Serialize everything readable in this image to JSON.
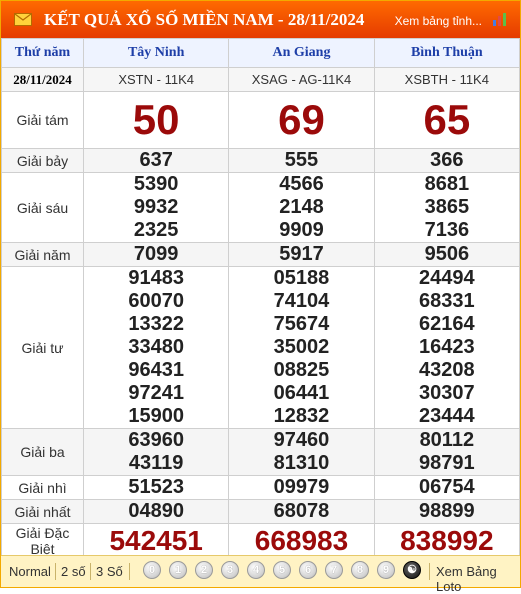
{
  "header": {
    "title": "KẾT QUẢ XỔ SỐ MIỀN NAM - 28/11/2024",
    "view_link": "Xem bảng tỉnh..."
  },
  "columns": {
    "head": "Thứ năm",
    "date": "28/11/2024",
    "provinces": [
      {
        "name": "Tây Ninh",
        "code": "XSTN - 11K4"
      },
      {
        "name": "An Giang",
        "code": "XSAG - AG-11K4"
      },
      {
        "name": "Bình Thuận",
        "code": "XSBTH - 11K4"
      }
    ]
  },
  "prizes": [
    {
      "label": "Giải tám",
      "style": "big",
      "values": [
        [
          "50"
        ],
        [
          "69"
        ],
        [
          "65"
        ]
      ]
    },
    {
      "label": "Giải bảy",
      "style": "num",
      "values": [
        [
          "637"
        ],
        [
          "555"
        ],
        [
          "366"
        ]
      ]
    },
    {
      "label": "Giải sáu",
      "style": "num",
      "values": [
        [
          "5390",
          "9932",
          "2325"
        ],
        [
          "4566",
          "2148",
          "9909"
        ],
        [
          "8681",
          "3865",
          "7136"
        ]
      ]
    },
    {
      "label": "Giải năm",
      "style": "num",
      "values": [
        [
          "7099"
        ],
        [
          "5917"
        ],
        [
          "9506"
        ]
      ]
    },
    {
      "label": "Giải tư",
      "style": "num",
      "values": [
        [
          "91483",
          "60070",
          "13322",
          "33480",
          "96431",
          "97241",
          "15900"
        ],
        [
          "05188",
          "74104",
          "75674",
          "35002",
          "08825",
          "06441",
          "12832"
        ],
        [
          "24494",
          "68331",
          "62164",
          "16423",
          "43208",
          "30307",
          "23444"
        ]
      ]
    },
    {
      "label": "Giải ba",
      "style": "num",
      "values": [
        [
          "63960",
          "43119"
        ],
        [
          "97460",
          "81310"
        ],
        [
          "80112",
          "98791"
        ]
      ]
    },
    {
      "label": "Giải nhì",
      "style": "num",
      "values": [
        [
          "51523"
        ],
        [
          "09979"
        ],
        [
          "06754"
        ]
      ]
    },
    {
      "label": "Giải nhất",
      "style": "num",
      "values": [
        [
          "04890"
        ],
        [
          "68078"
        ],
        [
          "98899"
        ]
      ]
    },
    {
      "label": "Giải Đặc Biệt",
      "style": "special",
      "values": [
        [
          "542451"
        ],
        [
          "668983"
        ],
        [
          "838992"
        ]
      ]
    }
  ],
  "footer": {
    "options": [
      "Normal",
      "2 số",
      "3 Số"
    ],
    "digits": [
      "0",
      "1",
      "2",
      "3",
      "4",
      "5",
      "6",
      "7",
      "8",
      "9"
    ],
    "loto_link": "Xem Bảng Loto"
  },
  "colors": {
    "header": "#ff6a00",
    "accent_red": "#9b0a0a",
    "head_blue": "#1e3fa8",
    "footer_bg": "#fff3c4"
  }
}
